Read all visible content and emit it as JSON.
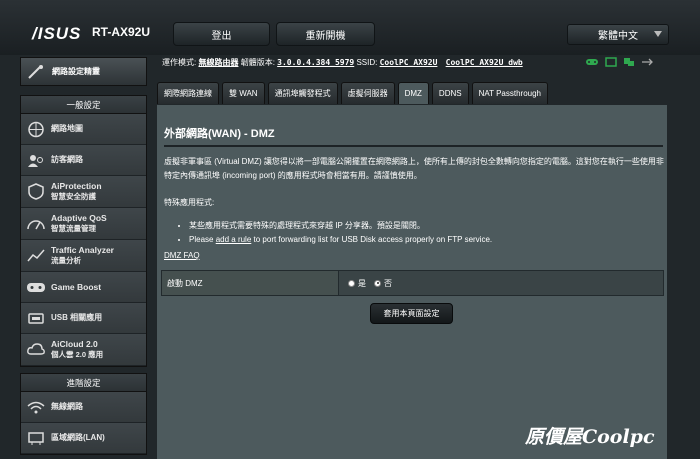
{
  "header": {
    "brand": "/ISUS",
    "model": "RT-AX92U",
    "logout": "登出",
    "reboot": "重新開機",
    "language": "繁體中文"
  },
  "status": {
    "mode_label": "運作模式:",
    "mode_value": "無線路由器",
    "firmware_label": "韌體版本:",
    "firmware_value": "3.0.0.4.384_5979",
    "ssid_label": "SSID:",
    "ssid_1": "CoolPC_AX92U",
    "ssid_2": "CoolPC_AX92U_dwb"
  },
  "sidebar": {
    "quick_setup": "網路設定精靈",
    "general_header": "一般設定",
    "general": [
      {
        "label": "網路地圖",
        "sub": ""
      },
      {
        "label": "訪客網路",
        "sub": ""
      },
      {
        "label": "AiProtection",
        "sub": "智慧安全防護"
      },
      {
        "label": "Adaptive QoS",
        "sub": "智慧流量管理"
      },
      {
        "label": "Traffic Analyzer",
        "sub": "流量分析"
      },
      {
        "label": "Game Boost",
        "sub": ""
      },
      {
        "label": "USB 相關應用",
        "sub": ""
      },
      {
        "label": "AiCloud 2.0",
        "sub": "個人雲 2.0 應用"
      }
    ],
    "advanced_header": "進階設定",
    "advanced": [
      {
        "label": "無線網路"
      },
      {
        "label": "區域網路(LAN)"
      }
    ]
  },
  "tabs": [
    "網際網路連線",
    "雙 WAN",
    "通訊埠觸發程式",
    "虛擬伺服器",
    "DMZ",
    "DDNS",
    "NAT Passthrough"
  ],
  "content": {
    "title": "外部網路(WAN) - DMZ",
    "description": "虛擬非軍事區 (Virtual DMZ) 讓您得以將一部電腦公開擺置在網際網路上，使所有上傳的封包全數轉向您指定的電腦。這對您在執行一些使用非特定內傳通訊埠 (incoming port) 的應用程式時會相當有用。請謹慎使用。",
    "special_apps": "特殊應用程式:",
    "note1": "某些應用程式需要特殊的處理程式來穿越 IP 分享器。預設是關閉。",
    "note2_pre": "Please",
    "note2_link": "add a rule",
    "note2_post": "to port forwarding list for USB Disk access properly on FTP service.",
    "faq": "DMZ FAQ",
    "dmz_label": "啟動 DMZ",
    "yes": "是",
    "no": "否",
    "dmz_enabled": false,
    "apply": "套用本頁面設定"
  },
  "watermark": "原價屋Coolpc"
}
